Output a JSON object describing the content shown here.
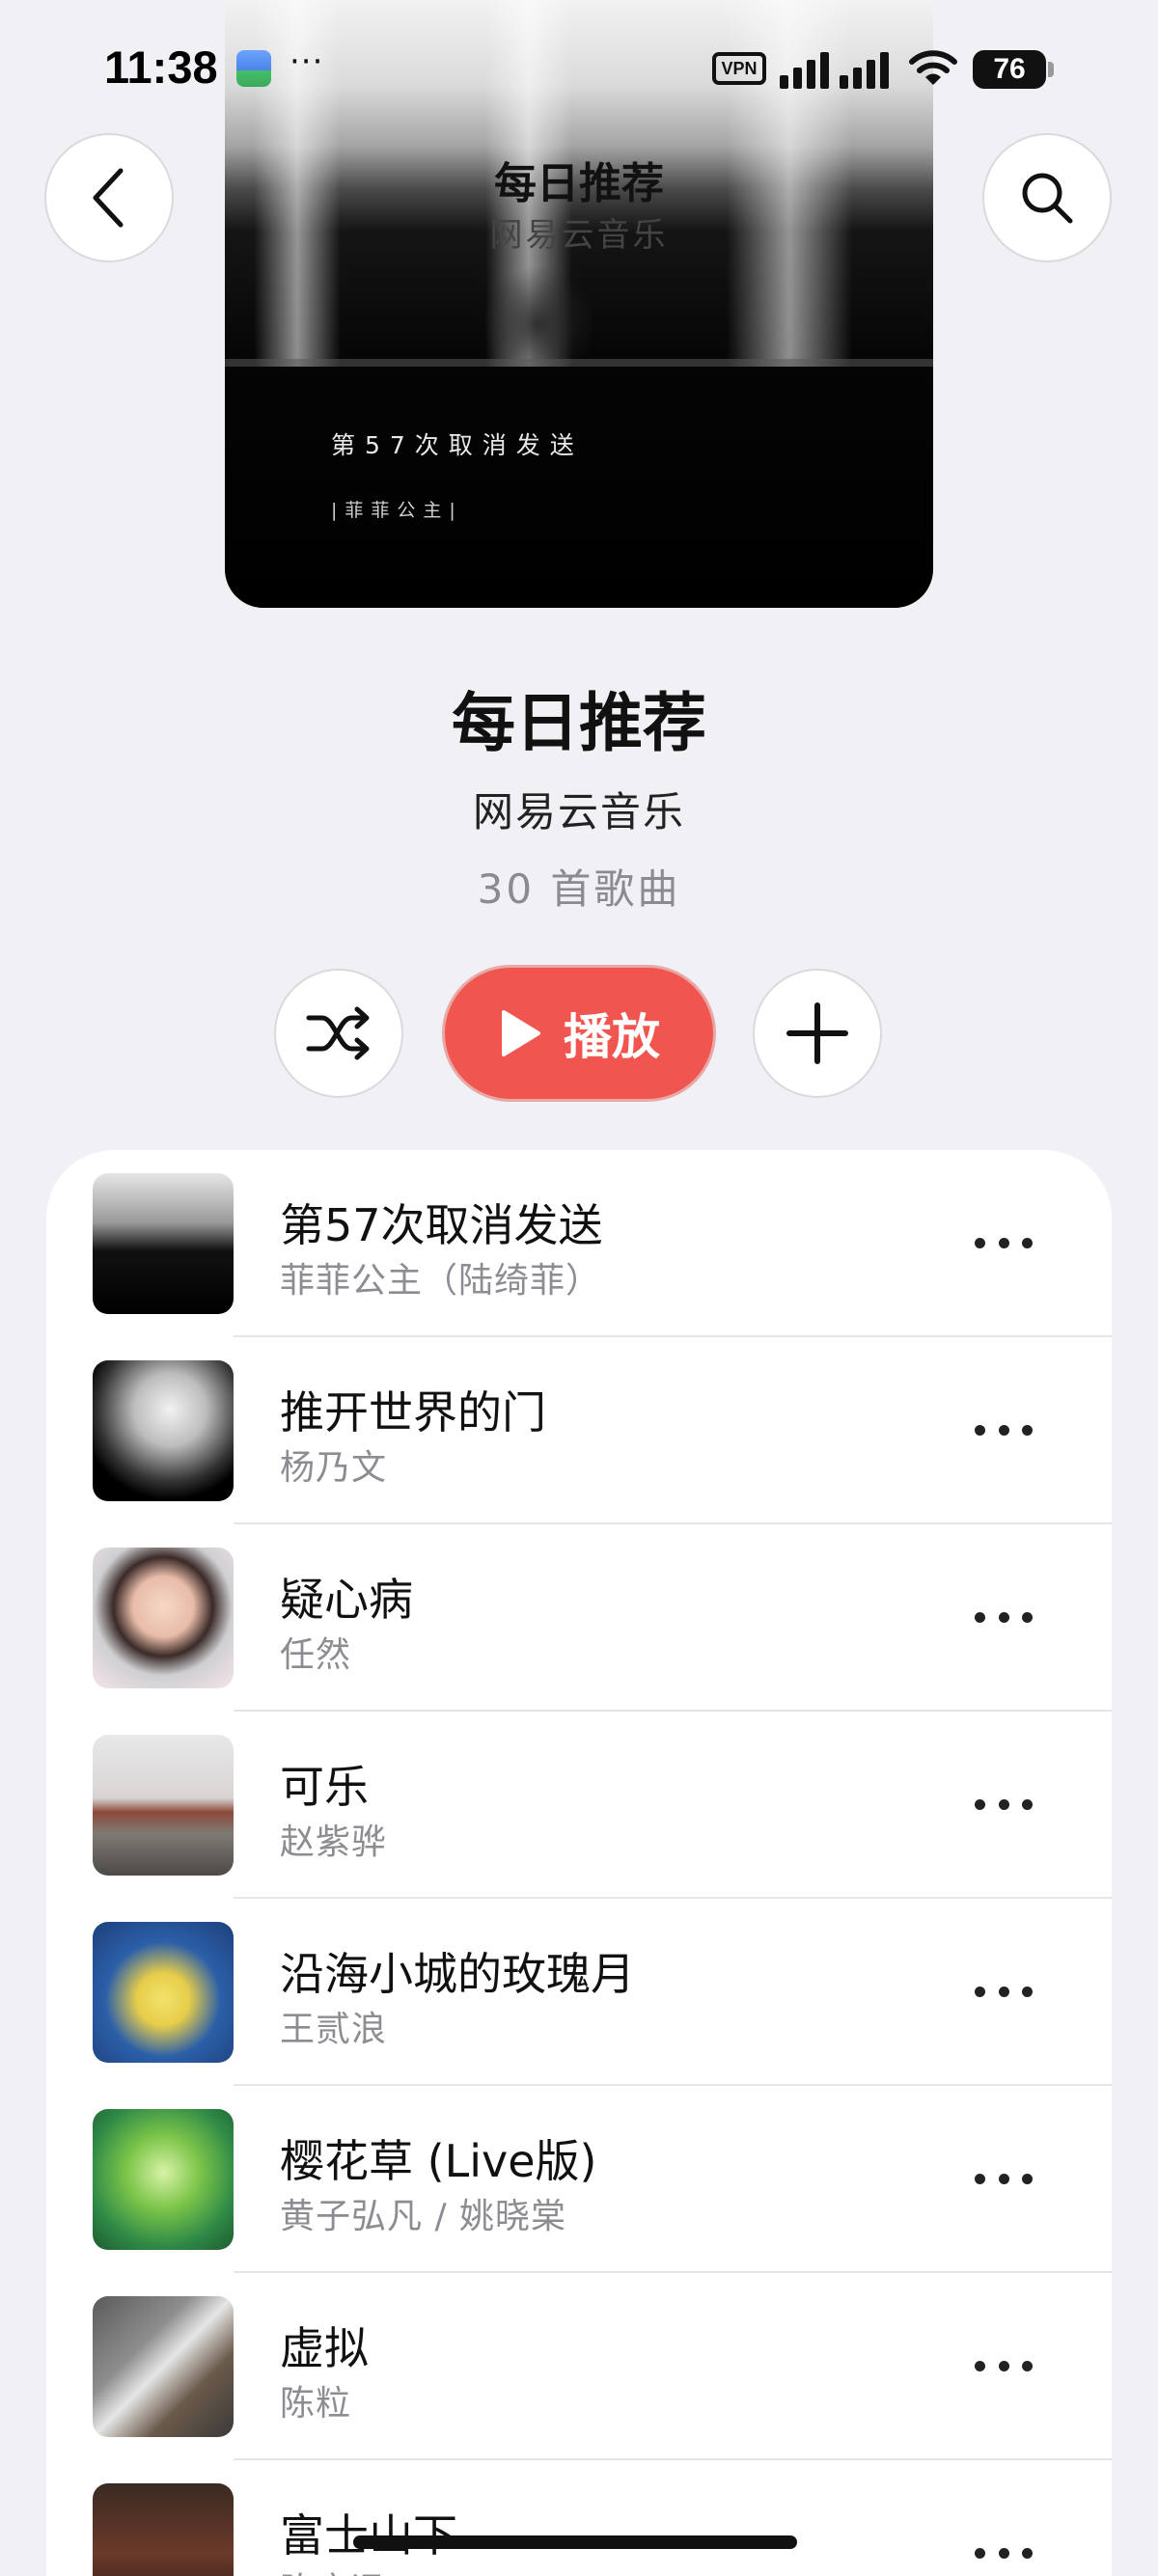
{
  "status_bar": {
    "time": "11:38",
    "more": "···",
    "vpn": "VPN",
    "battery": "76"
  },
  "cover": {
    "title": "每日推荐",
    "subtitle": "网易云音乐",
    "song": "第57次取消发送",
    "artist": "|菲菲公主|"
  },
  "header": {
    "back_icon": "chevron-left-icon",
    "search_icon": "search-icon"
  },
  "playlist": {
    "title": "每日推荐",
    "subtitle": "网易云音乐",
    "count": "30 首歌曲"
  },
  "actions": {
    "shuffle_icon": "shuffle-icon",
    "play_label": "播放",
    "add_icon": "plus-icon"
  },
  "colors": {
    "accent": "#f0554f",
    "background": "#f0f0f5",
    "secondary_text": "#8c8c92"
  },
  "songs": [
    {
      "title": "第57次取消发送",
      "artist": "菲菲公主（陆绮菲）"
    },
    {
      "title": "推开世界的门",
      "artist": "杨乃文"
    },
    {
      "title": "疑心病",
      "artist": "任然"
    },
    {
      "title": "可乐",
      "artist": "赵紫骅"
    },
    {
      "title": "沿海小城的玫瑰月",
      "artist": "王贰浪"
    },
    {
      "title": "樱花草 (Live版)",
      "artist": "黄子弘凡 / 姚晓棠"
    },
    {
      "title": "虚拟",
      "artist": "陈粒"
    },
    {
      "title": "富士山下",
      "artist": "陈奕迅"
    }
  ]
}
